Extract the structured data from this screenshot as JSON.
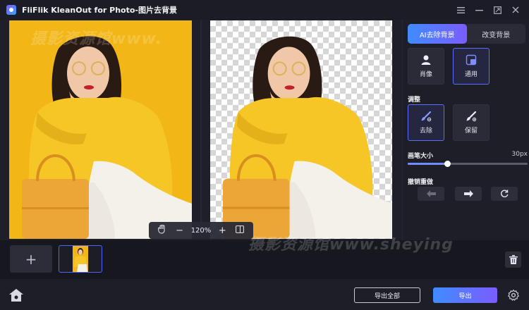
{
  "app": {
    "title": "FliFlik KleanOut for Photo-图片去背景"
  },
  "window_controls": {
    "menu_icon": "menu-icon",
    "minimize_icon": "minimize-icon",
    "maximize_icon": "maximize-icon",
    "close_icon": "close-icon"
  },
  "zoom": {
    "level": "120%",
    "zoom_out_label": "−",
    "zoom_in_label": "+"
  },
  "sidebar": {
    "tabs": [
      {
        "label": "AI去除背景",
        "active": true
      },
      {
        "label": "改变背景",
        "active": false
      }
    ],
    "modes": [
      {
        "label": "肖像",
        "icon": "person-icon",
        "selected": false
      },
      {
        "label": "通用",
        "icon": "layers-icon",
        "selected": true
      }
    ],
    "adjust_label": "调整",
    "tools": [
      {
        "label": "去除",
        "icon": "erase-brush-icon",
        "selected": true
      },
      {
        "label": "保留",
        "icon": "keep-brush-icon",
        "selected": false
      }
    ],
    "brush_size_label": "画笔大小",
    "brush_size_value": "30px",
    "brush_size_fraction": 0.33,
    "history_label": "撤销重做"
  },
  "strip": {
    "add_label": "+"
  },
  "footer": {
    "export_all_label": "导出全部",
    "export_label": "导出"
  },
  "watermarks": {
    "top": "摄影资源馆www.",
    "bottom": "摄影资源馆www.sheying"
  },
  "colors": {
    "accent_start": "#3f8cff",
    "accent_end": "#7b5cff",
    "photo_background": "#f2b617",
    "jacket": "#f5c626"
  }
}
